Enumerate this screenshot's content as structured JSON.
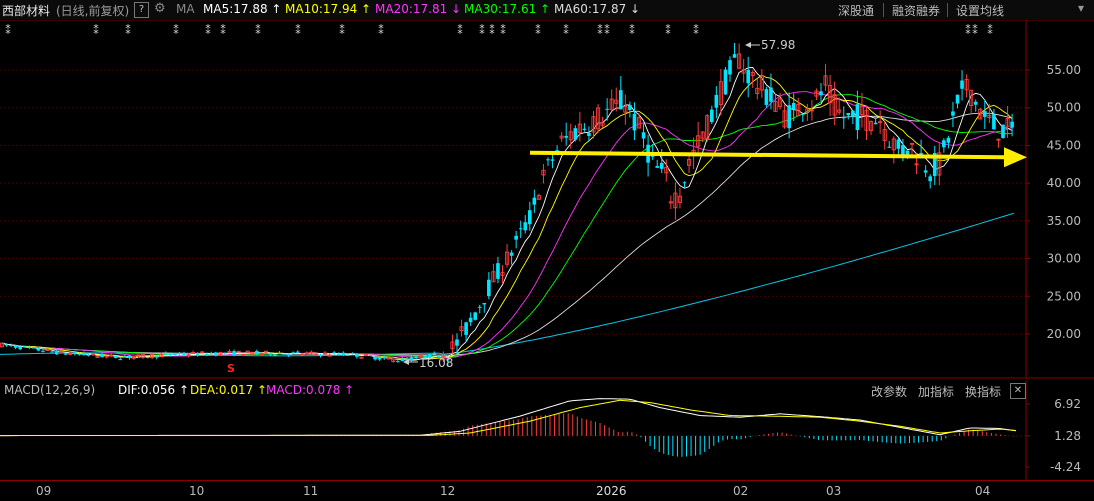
{
  "header": {
    "stock_name": "西部材料",
    "chart_mode": "(日线,前复权)",
    "help_label": "?",
    "ma_label": "MA",
    "ma5": "MA5:17.88 ↑",
    "ma10": "MA10:17.94 ↑",
    "ma20": "MA20:17.81 ↓",
    "ma30": "MA30:17.61 ↑",
    "ma60": "MA60:17.87 ↓",
    "links": [
      "深股通",
      "融资融券",
      "设置均线"
    ],
    "colors": {
      "ma5": "#ffffff",
      "ma10": "#ffff00",
      "ma20": "#ff33ff",
      "ma30": "#00ff00",
      "ma60": "#dddddd",
      "ma_long": "#00c8e6"
    }
  },
  "macd_header": {
    "title": "MACD(12,26,9)",
    "dif": "DIF:0.056 ↑",
    "dea": "DEA:0.017 ↑",
    "macd": "MACD:0.078 ↑",
    "buttons": [
      "改参数",
      "加指标",
      "换指标"
    ],
    "close_label": "✕"
  },
  "chart_data": {
    "type": "candlestick",
    "price_axis": {
      "ticks": [
        "55.00",
        "50.00",
        "45.00",
        "40.00",
        "35.00",
        "30.00",
        "25.00",
        "20.00"
      ],
      "range": [
        16.5,
        59.5
      ]
    },
    "annotations": {
      "high": "57.98",
      "low": "16.08"
    },
    "support_line": {
      "value": 43.7,
      "color": "#ffee00"
    },
    "macd_axis": {
      "ticks": [
        "6.92",
        "1.28",
        "-4.24"
      ],
      "range": [
        -4.24,
        6.92
      ]
    },
    "date_labels": [
      "09",
      "10",
      "11",
      "12",
      "2026",
      "02",
      "03",
      "04"
    ],
    "candle_colors": {
      "up": "#ff3c3c",
      "down": "#00e5ff"
    }
  }
}
